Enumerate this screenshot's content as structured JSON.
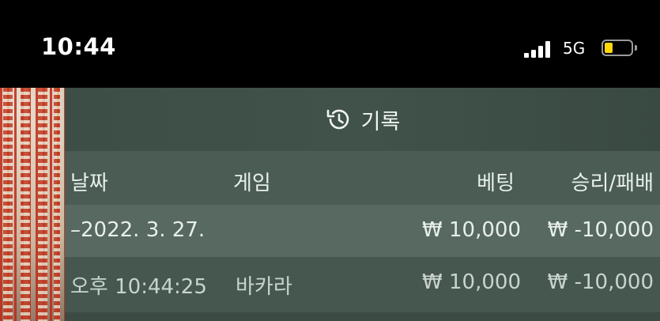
{
  "status_bar": {
    "time": "10:44",
    "network": "5G",
    "battery_level": 0.25,
    "battery_color": "#ffd60a"
  },
  "history": {
    "title": "기록",
    "icon": "history-icon",
    "columns": {
      "date": "날짜",
      "game": "게임",
      "bet": "베팅",
      "result": "승리/패배"
    },
    "date_row": {
      "date": "–2022. 3. 27.",
      "bet": "₩ 10,000",
      "result": "₩ -10,000"
    },
    "entries": [
      {
        "time": "오후 10:44:25",
        "game": "바카라",
        "bet": "₩ 10,000",
        "result": "₩ -10,000"
      }
    ]
  }
}
